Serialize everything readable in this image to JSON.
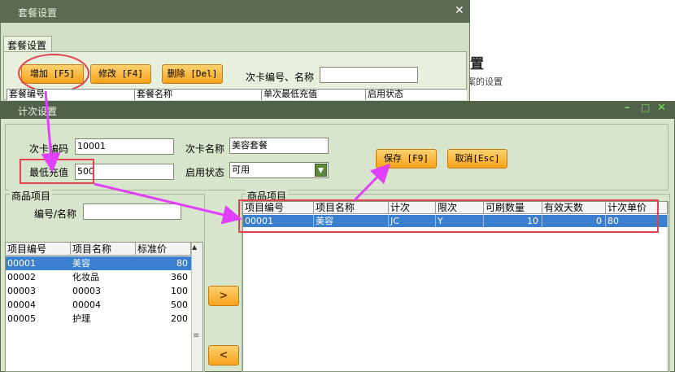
{
  "background_page": {
    "heading": "置",
    "subtext": "案的设置"
  },
  "back_window": {
    "title": "套餐设置",
    "close_glyph": "✕",
    "tab": "套餐设置",
    "buttons": {
      "add": "增加 [F5]",
      "edit": "修改 [F4]",
      "delete": "删除 [Del]"
    },
    "search_label": "次卡编号、名称",
    "grid_headers": [
      "套餐编号",
      "套餐名称",
      "单次最低充值",
      "启用状态"
    ]
  },
  "front_window": {
    "title": "计次设置",
    "controls": {
      "minimize": "–",
      "maximize": "□",
      "close": "✕"
    },
    "form": {
      "card_code_label": "次卡编码",
      "card_code_value": "10001",
      "card_name_label": "次卡名称",
      "card_name_value": "美容套餐",
      "min_recharge_label": "最低充值",
      "min_recharge_value": "500",
      "status_label": "启用状态",
      "status_value": "可用",
      "save_button": "保存 [F9]",
      "cancel_button": "取消[Esc]"
    },
    "left_panel": {
      "title": "商品项目",
      "search_label": "编号/名称",
      "headers": [
        "项目编号",
        "项目名称",
        "标准价"
      ],
      "rows": [
        {
          "code": "00001",
          "name": "美容",
          "price": "80"
        },
        {
          "code": "00002",
          "name": "化妆品",
          "price": "360"
        },
        {
          "code": "00003",
          "name": "00003",
          "price": "100"
        },
        {
          "code": "00004",
          "name": "00004",
          "price": "500"
        },
        {
          "code": "00005",
          "name": "护理",
          "price": "200"
        }
      ],
      "selected_index": 0
    },
    "move_buttons": {
      "add": ">",
      "remove": "<"
    },
    "right_panel": {
      "title": "商品项目",
      "headers": [
        "项目编号",
        "项目名称",
        "计次",
        "限次",
        "可刷数量",
        "有效天数",
        "计次单价"
      ],
      "rows": [
        {
          "code": "00001",
          "name": "美容",
          "count_type": "JC",
          "limited": "Y",
          "quantity": "10",
          "valid_days": "0",
          "unit_price": "80"
        }
      ]
    }
  },
  "colors": {
    "window_title": "#51624a",
    "window_body": "#d8e5cd",
    "orange_button": "#f7a21b",
    "selection": "#3a7fd0",
    "annotation_red": "#e3414b",
    "annotation_arrow": "#e040fb"
  }
}
